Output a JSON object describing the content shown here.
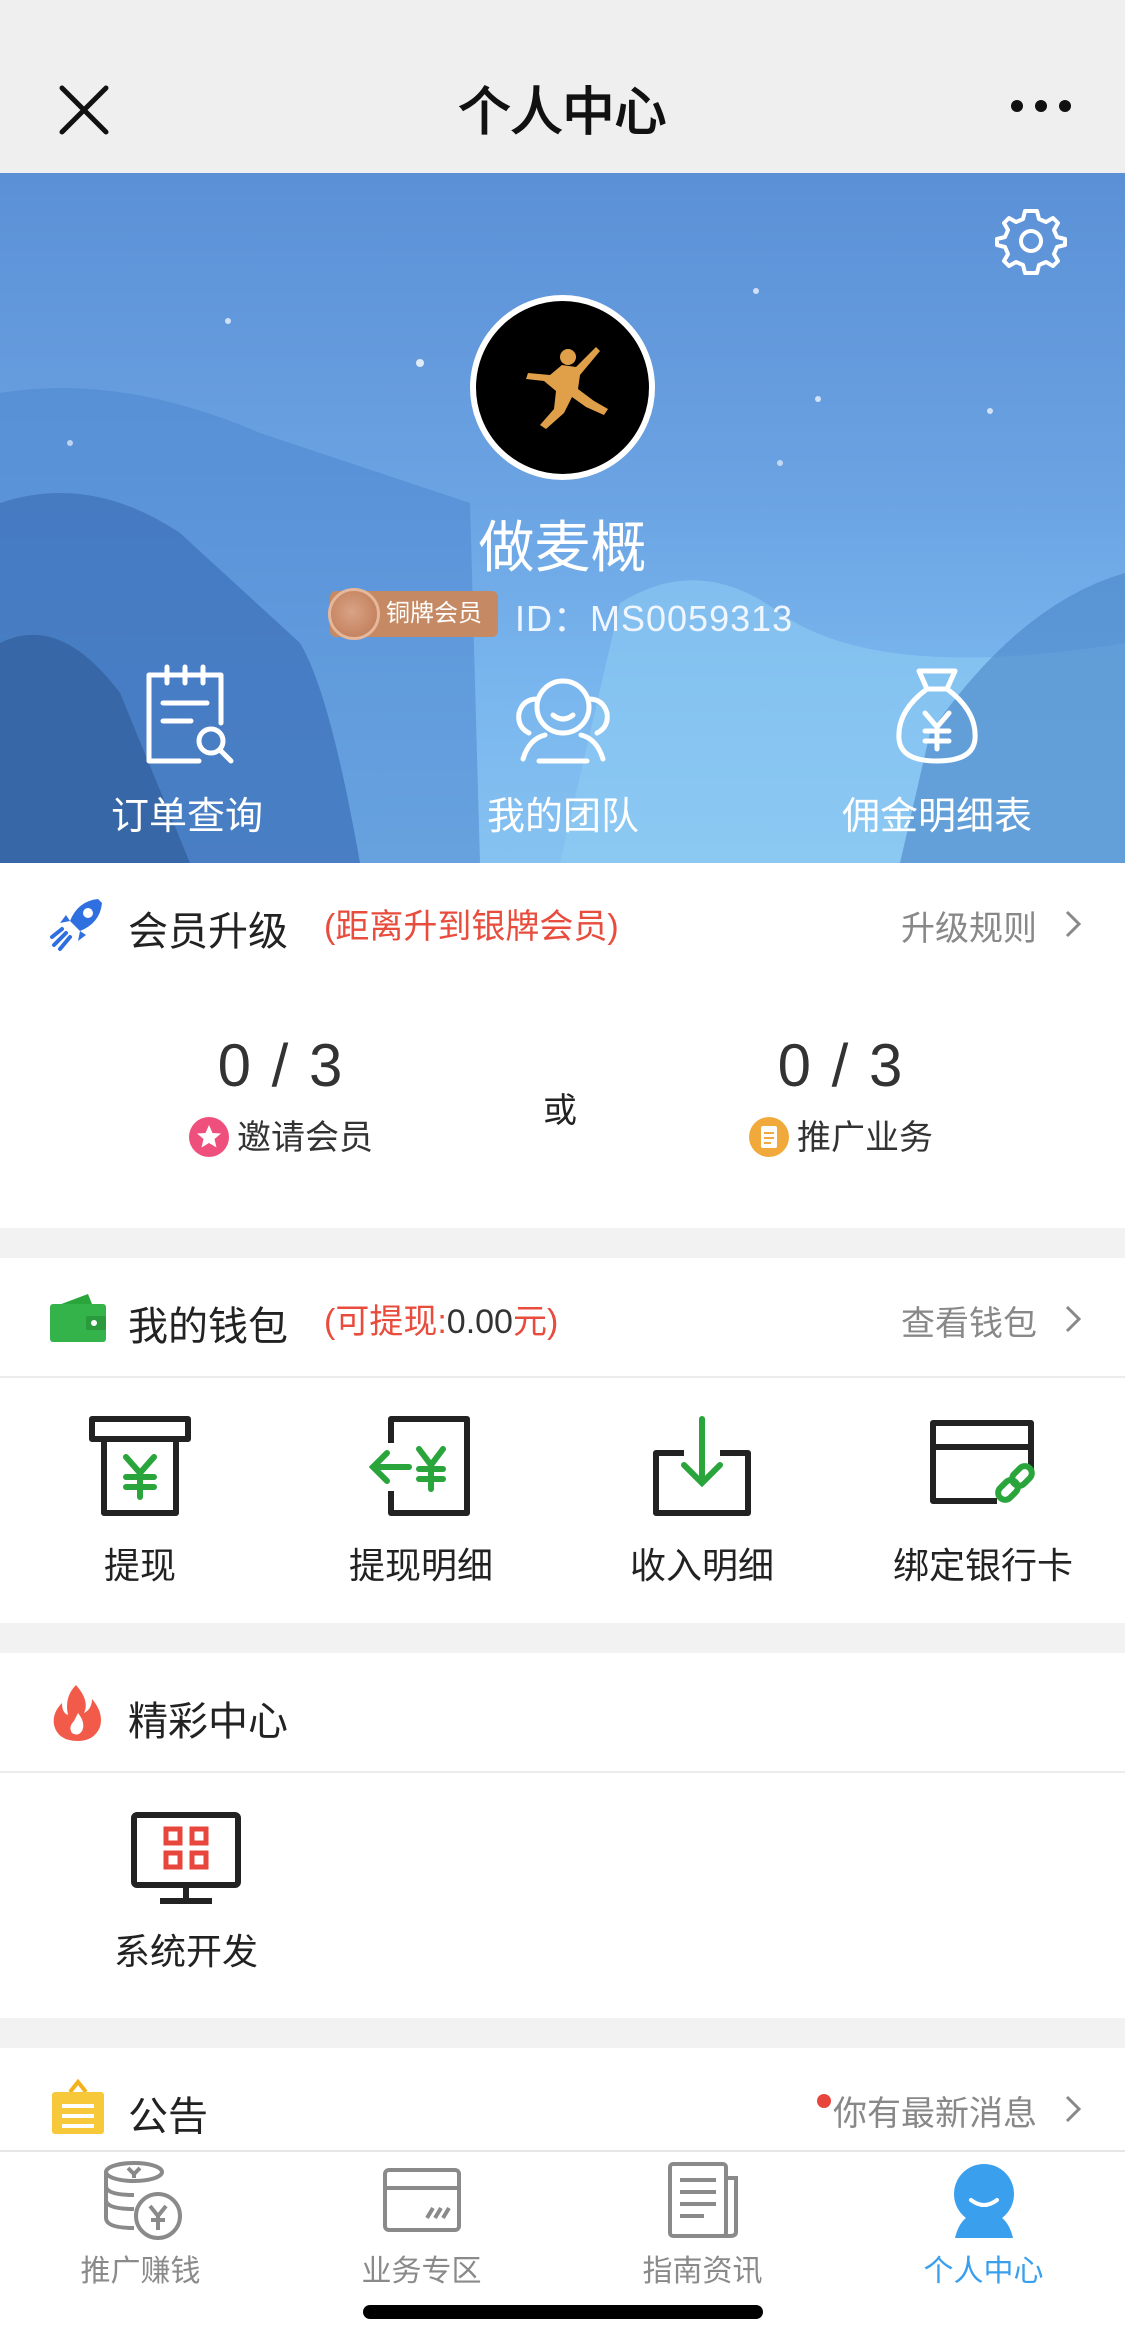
{
  "navbar": {
    "title": "个人中心"
  },
  "profile": {
    "username": "做麦概",
    "level_badge": "铜牌会员",
    "user_id": "ID：MS0059313"
  },
  "quick_actions": [
    {
      "label": "订单查询",
      "icon": "order-search-icon"
    },
    {
      "label": "我的团队",
      "icon": "team-icon"
    },
    {
      "label": "佣金明细表",
      "icon": "money-bag-icon"
    }
  ],
  "upgrade": {
    "title": "会员升级",
    "subtitle": "(距离升到银牌会员)",
    "link": "升级规则",
    "or_text": "或",
    "items": [
      {
        "value": "0 / 3",
        "label": "邀请会员",
        "color": "#ee4f7c"
      },
      {
        "value": "0 / 3",
        "label": "推广业务",
        "color": "#f0a93a"
      }
    ]
  },
  "wallet": {
    "title": "我的钱包",
    "subtitle_prefix": "(可提现:",
    "amount": "0.00",
    "subtitle_suffix": "元)",
    "link": "查看钱包",
    "items": [
      {
        "label": "提现",
        "icon": "withdraw-icon"
      },
      {
        "label": "提现明细",
        "icon": "withdraw-detail-icon"
      },
      {
        "label": "收入明细",
        "icon": "income-detail-icon"
      },
      {
        "label": "绑定银行卡",
        "icon": "bind-card-icon"
      }
    ]
  },
  "featured": {
    "title": "精彩中心",
    "items": [
      {
        "label": "系统开发",
        "icon": "monitor-icon"
      }
    ]
  },
  "notice": {
    "title": "公告",
    "link": "你有最新消息"
  },
  "tabbar": {
    "active": 3,
    "accent": "#3aa0ee",
    "items": [
      {
        "label": "推广赚钱",
        "icon": "coins-icon"
      },
      {
        "label": "业务专区",
        "icon": "card-icon"
      },
      {
        "label": "指南资讯",
        "icon": "news-icon"
      },
      {
        "label": "个人中心",
        "icon": "person-icon"
      }
    ]
  }
}
